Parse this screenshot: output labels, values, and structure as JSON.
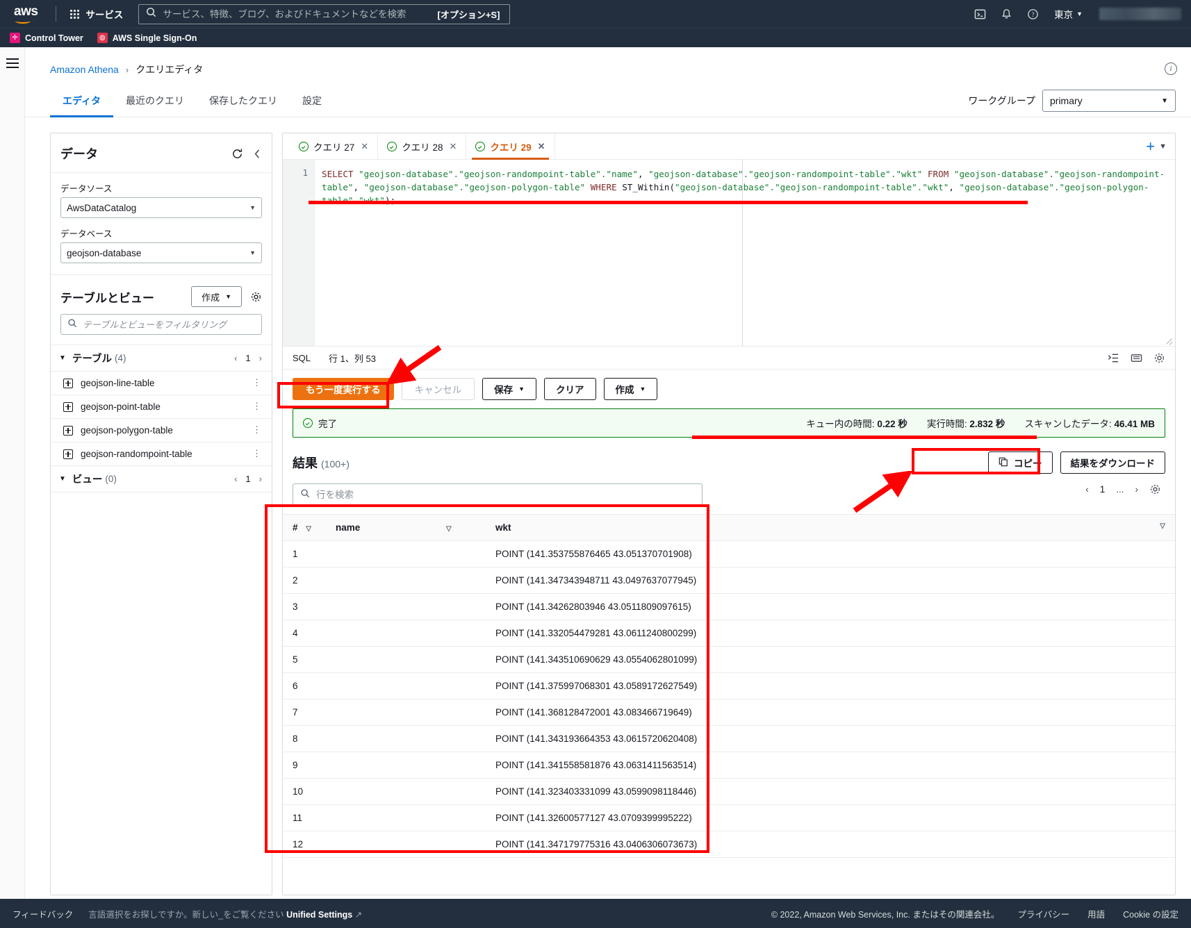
{
  "topnav": {
    "logo": "aws",
    "services_label": "サービス",
    "search_placeholder": "サービス、特徴、ブログ、およびドキュメントなどを検索",
    "search_value": "",
    "search_shortcut": "[オプション+S]",
    "region": "東京",
    "icons": [
      "cloudshell-icon",
      "bell-icon",
      "help-icon"
    ]
  },
  "favorites": [
    {
      "label": "Control Tower",
      "color": "#e7157b",
      "glyph": "✛"
    },
    {
      "label": "AWS Single SSO",
      "display": "AWS Single Sign-On",
      "color": "#dd344c",
      "glyph": "◍"
    }
  ],
  "breadcrumb": {
    "root": "Amazon Athena",
    "separator": "›",
    "current": "クエリエディタ"
  },
  "page_tabs": [
    {
      "label": "エディタ",
      "active": true
    },
    {
      "label": "最近のクエリ",
      "active": false
    },
    {
      "label": "保存したクエリ",
      "active": false
    },
    {
      "label": "設定",
      "active": false
    }
  ],
  "workgroup": {
    "label": "ワークグループ",
    "value": "primary"
  },
  "data_panel": {
    "title": "データ",
    "datasource_label": "データソース",
    "datasource_value": "AwsDataCatalog",
    "database_label": "データベース",
    "database_value": "geojson-database",
    "tables_views_title": "テーブルとビュー",
    "create_button": "作成",
    "filter_placeholder": "テーブルとビューをフィルタリング",
    "filter_value": "",
    "tables_group": {
      "name": "テーブル",
      "count": "(4)",
      "page": "1"
    },
    "tables": [
      "geojson-line-table",
      "geojson-point-table",
      "geojson-polygon-table",
      "geojson-randompoint-table"
    ],
    "views_group": {
      "name": "ビュー",
      "count": "(0)",
      "page": "1"
    }
  },
  "query_tabs": [
    {
      "label": "クエリ 27",
      "active": false
    },
    {
      "label": "クエリ 28",
      "active": false
    },
    {
      "label": "クエリ 29",
      "active": true
    }
  ],
  "editor": {
    "line_number": "1",
    "sql_segments": [
      {
        "t": "SELECT ",
        "c": "kw"
      },
      {
        "t": "\"geojson-database\".\"geojson-randompoint-table\".\"name\"",
        "c": "str"
      },
      {
        "t": ", ",
        "c": "plain"
      },
      {
        "t": "\"geojson-database\".\"geojson-randompoint-table\".\"wkt\"",
        "c": "str"
      },
      {
        "t": " FROM ",
        "c": "kw"
      },
      {
        "t": "\"geojson-database\".\"geojson-randompoint-table\"",
        "c": "str"
      },
      {
        "t": ", ",
        "c": "plain"
      },
      {
        "t": "\"geojson-database\".\"geojson-polygon-table\"",
        "c": "str"
      },
      {
        "t": " WHERE ",
        "c": "kw"
      },
      {
        "t": "ST_Within(",
        "c": "plain"
      },
      {
        "t": "\"geojson-database\".\"geojson-randompoint-table\".\"wkt\"",
        "c": "str"
      },
      {
        "t": ", ",
        "c": "plain"
      },
      {
        "t": "\"geojson-database\".\"geojson-polygon-table\".\"wkt\"",
        "c": "str"
      },
      {
        "t": ");",
        "c": "plain"
      }
    ],
    "status_lang": "SQL",
    "status_pos": "行 1、列 53"
  },
  "toolbar": {
    "run_again": "もう一度実行する",
    "cancel": "キャンセル",
    "save": "保存",
    "clear": "クリア",
    "create": "作成"
  },
  "run_status": {
    "state": "完了",
    "queue_label": "キュー内の時間:",
    "queue_value": "0.22 秒",
    "runtime_label": "実行時間:",
    "runtime_value": "2.832 秒",
    "scanned_label": "スキャンしたデータ:",
    "scanned_value": "46.41 MB"
  },
  "results": {
    "title": "結果",
    "count": "(100+)",
    "copy_button": "コピー",
    "download_button": "結果をダウンロード",
    "search_placeholder": "行を検索",
    "search_value": "",
    "page_current": "1",
    "page_ellipsis": "...",
    "columns": [
      "#",
      "name",
      "wkt"
    ],
    "rows": [
      {
        "n": "1",
        "name": "",
        "wkt": "POINT (141.353755876465 43.051370701908)"
      },
      {
        "n": "2",
        "name": "",
        "wkt": "POINT (141.347343948711 43.0497637077945)"
      },
      {
        "n": "3",
        "name": "",
        "wkt": "POINT (141.34262803946 43.0511809097615)"
      },
      {
        "n": "4",
        "name": "",
        "wkt": "POINT (141.332054479281 43.0611240800299)"
      },
      {
        "n": "5",
        "name": "",
        "wkt": "POINT (141.343510690629 43.0554062801099)"
      },
      {
        "n": "6",
        "name": "",
        "wkt": "POINT (141.375997068301 43.0589172627549)"
      },
      {
        "n": "7",
        "name": "",
        "wkt": "POINT (141.368128472001 43.083466719649)"
      },
      {
        "n": "8",
        "name": "",
        "wkt": "POINT (141.343193664353 43.0615720620408)"
      },
      {
        "n": "9",
        "name": "",
        "wkt": "POINT (141.341558581876 43.0631411563514)"
      },
      {
        "n": "10",
        "name": "",
        "wkt": "POINT (141.323403331099 43.0599098118446)"
      },
      {
        "n": "11",
        "name": "",
        "wkt": "POINT (141.32600577127 43.0709399995222)"
      },
      {
        "n": "12",
        "name": "",
        "wkt": "POINT (141.347179775316 43.0406306073673)"
      }
    ]
  },
  "footer": {
    "feedback": "フィードバック",
    "lang_note": "言語選択をお探しですか。新しい_をご覧ください",
    "unified_settings": "Unified Settings",
    "copyright": "© 2022, Amazon Web Services, Inc. またはその関連会社。",
    "privacy": "プライバシー",
    "terms": "用語",
    "cookies": "Cookie の設定"
  }
}
